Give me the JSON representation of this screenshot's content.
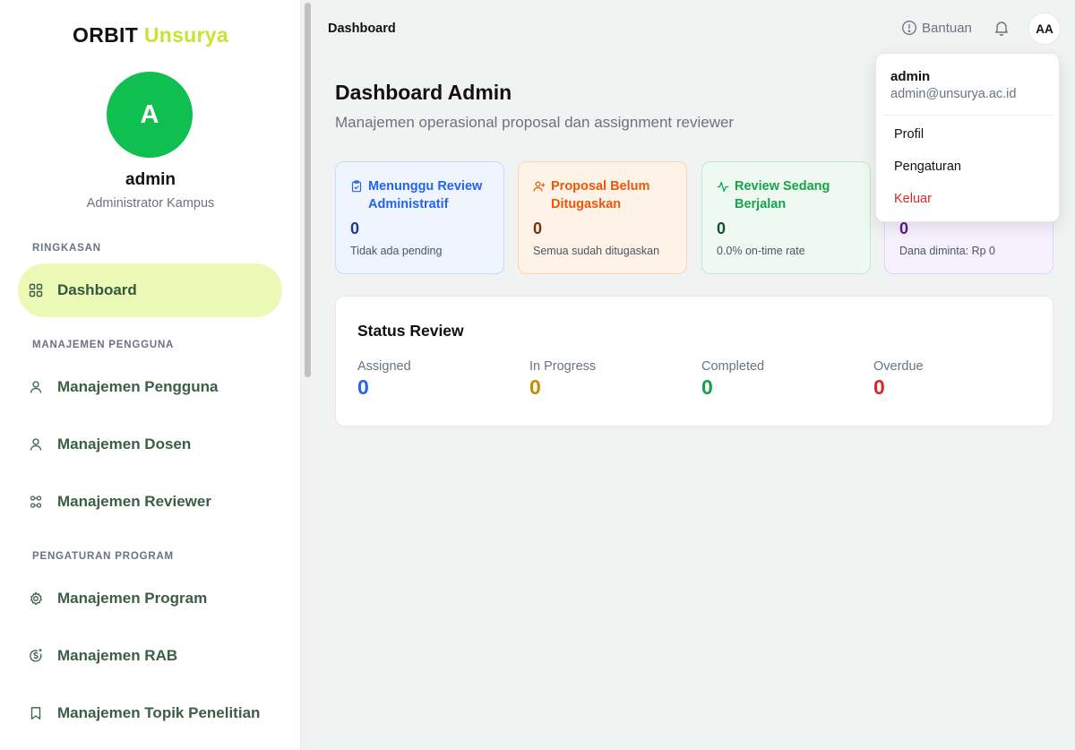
{
  "sidebar": {
    "brand_main": "ORBIT",
    "brand_accent": "Unsurya",
    "avatar_initial": "A",
    "user_name": "admin",
    "user_role": "Administrator Kampus",
    "sections": [
      {
        "label": "RINGKASAN",
        "items": [
          {
            "label": "Dashboard",
            "icon": "grid-icon",
            "active": true
          }
        ]
      },
      {
        "label": "MANAJEMEN PENGGUNA",
        "items": [
          {
            "label": "Manajemen Pengguna",
            "icon": "user-icon"
          },
          {
            "label": "Manajemen Dosen",
            "icon": "user-icon"
          },
          {
            "label": "Manajemen Reviewer",
            "icon": "users-network-icon"
          }
        ]
      },
      {
        "label": "PENGATURAN PROGRAM",
        "items": [
          {
            "label": "Manajemen Program",
            "icon": "gear-icon"
          },
          {
            "label": "Manajemen RAB",
            "icon": "dollar-circle-icon"
          },
          {
            "label": "Manajemen Topik Penelitian",
            "icon": "bookmark-icon"
          }
        ]
      }
    ]
  },
  "header": {
    "breadcrumb": "Dashboard",
    "help_label": "Bantuan",
    "avatar_initials": "AA"
  },
  "main": {
    "title": "Dashboard Admin",
    "subtitle": "Manajemen operasional proposal dan assignment reviewer",
    "cards": [
      {
        "title": "Menunggu Review Administratif",
        "value": "0",
        "desc": "Tidak ada pending",
        "icon": "clipboard-check-icon",
        "color": "#2563eb"
      },
      {
        "title": "Proposal Belum Ditugaskan",
        "value": "0",
        "desc": "Semua sudah ditugaskan",
        "icon": "user-plus-icon",
        "color": "#ea580c"
      },
      {
        "title": "Review Sedang Berjalan",
        "value": "0",
        "desc": "0.0% on-time rate",
        "icon": "activity-icon",
        "color": "#16a34a"
      },
      {
        "title": "",
        "value": "0",
        "desc": "Dana diminta: Rp 0",
        "icon": "",
        "color": "#7c3aed"
      }
    ],
    "status_review": {
      "title": "Status Review",
      "items": [
        {
          "label": "Assigned",
          "value": "0",
          "color": "#2563eb"
        },
        {
          "label": "In Progress",
          "value": "0",
          "color": "#ca8a04"
        },
        {
          "label": "Completed",
          "value": "0",
          "color": "#16a34a"
        },
        {
          "label": "Overdue",
          "value": "0",
          "color": "#dc2626"
        }
      ]
    }
  },
  "dropdown": {
    "name": "admin",
    "email": "admin@unsurya.ac.id",
    "items": [
      "Profil",
      "Pengaturan",
      "Keluar"
    ]
  },
  "colors": {
    "brand_accent": "#c9e234",
    "avatar_green": "#0fbf4f",
    "active_nav_bg": "#ecf8b6",
    "nav_text": "#3b5e46"
  }
}
